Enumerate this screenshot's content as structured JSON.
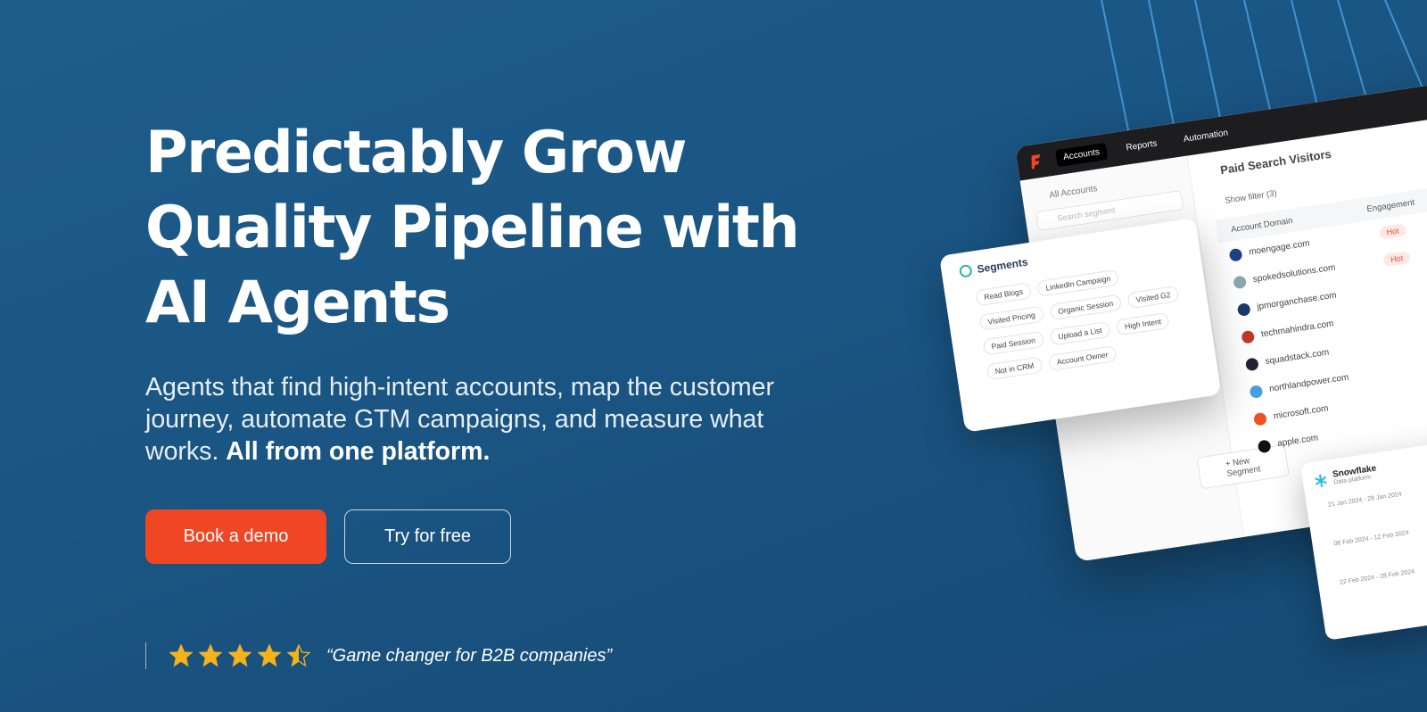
{
  "hero": {
    "headline_line1": "Predictably Grow",
    "headline_line2": "Quality Pipeline with",
    "headline_line3": "AI Agents",
    "subhead": "Agents that find high-intent accounts, map the customer journey, automate GTM campaigns, and measure what works.",
    "subhead_bold": "All from one platform."
  },
  "cta": {
    "primary_label": "Book a demo",
    "secondary_label": "Try for free"
  },
  "review": {
    "rating": 4.5,
    "max": 5,
    "quote": "“Game changer for B2B companies”"
  },
  "mockup": {
    "nav": [
      "Accounts",
      "Reports",
      "Automation"
    ],
    "sidebar_all": "All Accounts",
    "search_placeholder": "Search segment",
    "new_segment": "+ New Segment",
    "page_title": "Paid Search Visitors",
    "filter": "Show filter (3)",
    "columns": [
      "Account Domain",
      "Engagement"
    ],
    "rows": [
      {
        "domain": "moengage.com",
        "badge": "Hot"
      },
      {
        "domain": "spokedsolutions.com",
        "badge": "Hot"
      },
      {
        "domain": "jpmorganchase.com",
        "badge": ""
      },
      {
        "domain": "techmahindra.com",
        "badge": ""
      },
      {
        "domain": "squadstack.com",
        "badge": ""
      },
      {
        "domain": "northlandpower.com",
        "badge": ""
      },
      {
        "domain": "microsoft.com",
        "badge": ""
      },
      {
        "domain": "apple.com",
        "badge": ""
      }
    ],
    "segments_title": "Segments",
    "segments": [
      "Read Blogs",
      "LinkedIn Campaign",
      "Visited Pricing",
      "Organic Session",
      "Visited G2",
      "Paid Session",
      "Upload a List",
      "High Intent",
      "Not in CRM",
      "Account Owner"
    ],
    "snowflake_name": "Snowflake",
    "snowflake_sub": "Data platform",
    "date_ranges": [
      "21 Jan 2024 - 28 Jan 2024",
      "06 Feb 2024 - 12 Feb 2024",
      "22 Feb 2024 - 28 Feb 2024"
    ]
  },
  "colors": {
    "accent": "#f04624",
    "background": "#1a5583",
    "star": "#f6b21b"
  }
}
